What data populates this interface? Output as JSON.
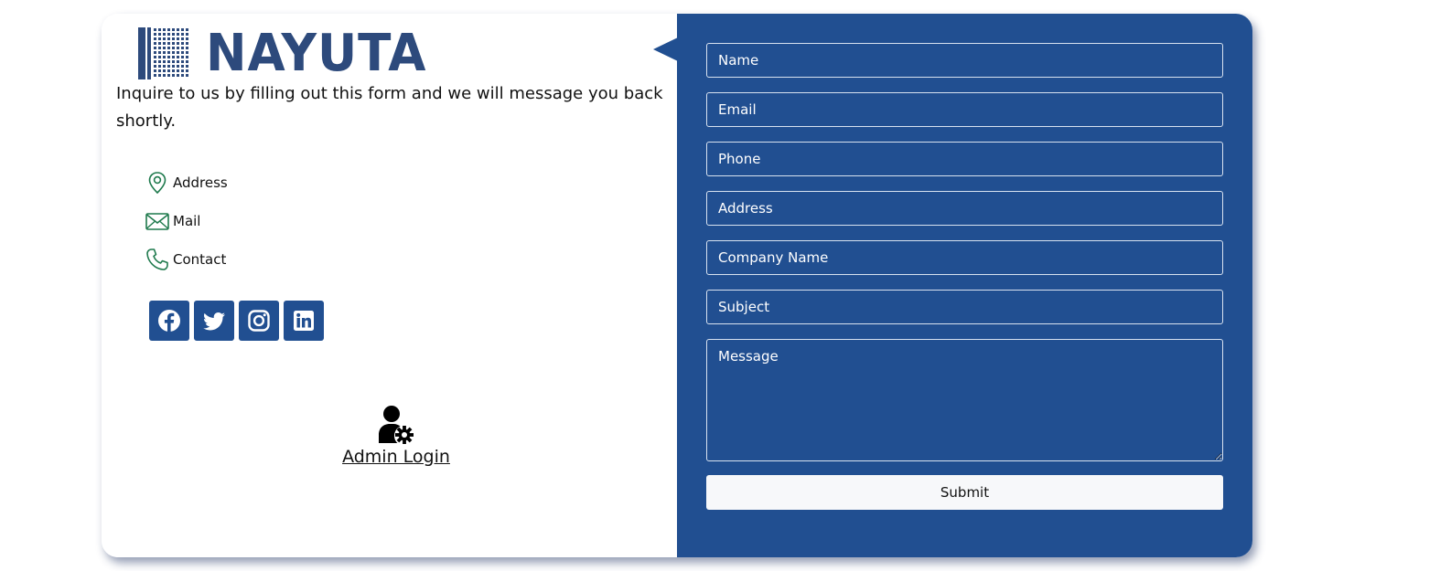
{
  "brand": {
    "logo_text": "NAYUTA",
    "logo_color": "#2d4a7c"
  },
  "intro": {
    "text": "Inquire to us by filling out this form and we will message you back shortly."
  },
  "contact_info": [
    {
      "icon": "map-pin-icon",
      "label": "Address"
    },
    {
      "icon": "mail-icon",
      "label": "Mail"
    },
    {
      "icon": "phone-icon",
      "label": "Contact"
    }
  ],
  "socials": [
    {
      "icon": "facebook-icon"
    },
    {
      "icon": "twitter-icon"
    },
    {
      "icon": "instagram-icon"
    },
    {
      "icon": "linkedin-icon"
    }
  ],
  "admin": {
    "icon": "admin-user-gear-icon",
    "label": "Admin Login"
  },
  "form": {
    "name_placeholder": "Name",
    "email_placeholder": "Email",
    "phone_placeholder": "Phone",
    "address_placeholder": "Address",
    "company_placeholder": "Company Name",
    "subject_placeholder": "Subject",
    "message_placeholder": "Message",
    "submit_label": "Submit"
  },
  "colors": {
    "panel": "#214f91",
    "icon_green": "#1f7a4d",
    "submit_bg": "#f7f8fa"
  }
}
